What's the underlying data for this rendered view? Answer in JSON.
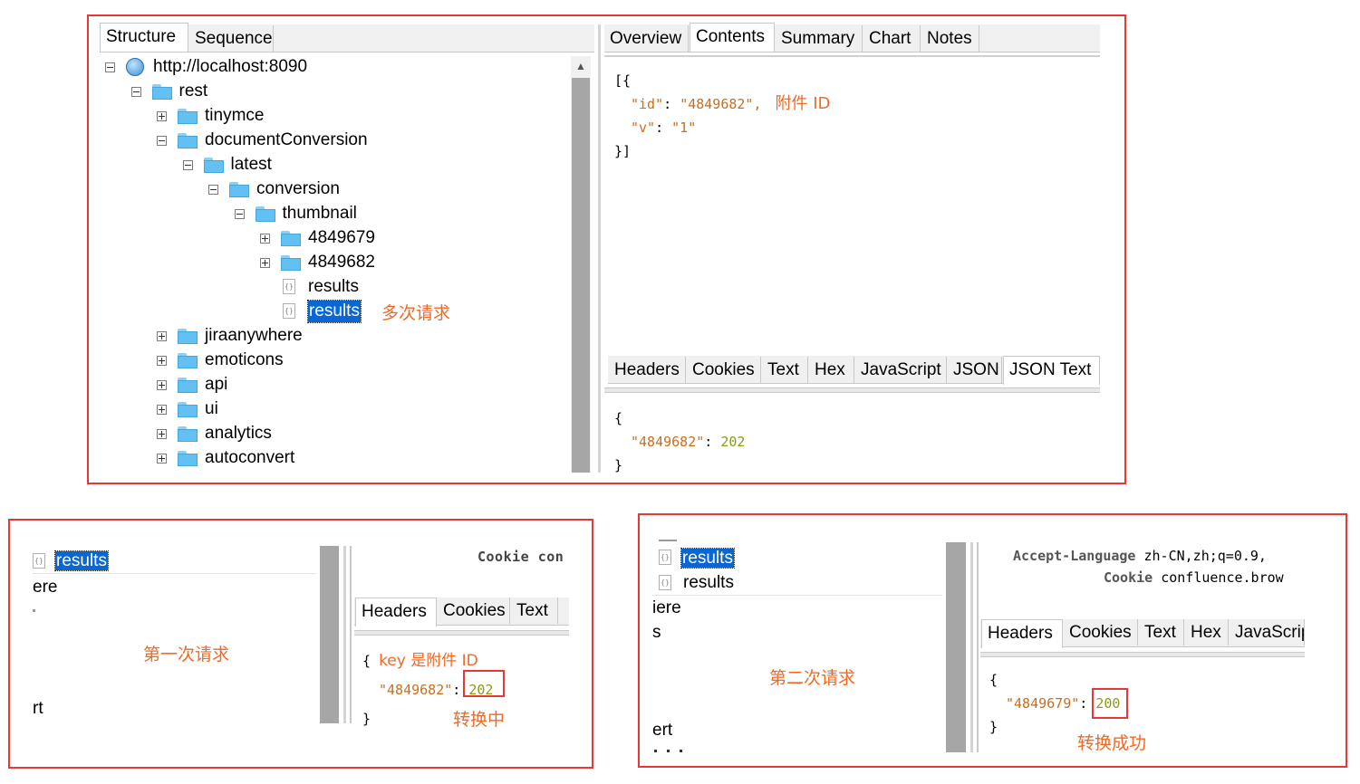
{
  "main": {
    "left_tabs": [
      "Structure",
      "Sequence"
    ],
    "right_tabs": [
      "Overview",
      "Contents",
      "Summary",
      "Chart",
      "Notes"
    ],
    "tree": [
      {
        "label": "http://localhost:8090",
        "icon": "globe-icon",
        "expander": "minus"
      },
      {
        "label": "rest",
        "icon": "folder-icon",
        "expander": "minus"
      },
      {
        "label": "tinymce",
        "icon": "folder-icon",
        "expander": "plus"
      },
      {
        "label": "documentConversion",
        "icon": "folder-icon",
        "expander": "minus"
      },
      {
        "label": "latest",
        "icon": "folder-icon",
        "expander": "minus"
      },
      {
        "label": "conversion",
        "icon": "folder-icon",
        "expander": "minus"
      },
      {
        "label": "thumbnail",
        "icon": "folder-icon",
        "expander": "minus"
      },
      {
        "label": "4849679",
        "icon": "folder-icon",
        "expander": "plus"
      },
      {
        "label": "4849682",
        "icon": "folder-icon",
        "expander": "plus"
      },
      {
        "label": "results",
        "icon": "json-file-icon",
        "expander": "none"
      },
      {
        "label": "results",
        "icon": "json-file-icon",
        "expander": "none",
        "selected": true
      },
      {
        "label": "jiraanywhere",
        "icon": "folder-icon",
        "expander": "plus"
      },
      {
        "label": "emoticons",
        "icon": "folder-icon",
        "expander": "plus"
      },
      {
        "label": "api",
        "icon": "folder-icon",
        "expander": "plus"
      },
      {
        "label": "ui",
        "icon": "folder-icon",
        "expander": "plus"
      },
      {
        "label": "analytics",
        "icon": "folder-icon",
        "expander": "plus"
      },
      {
        "label": "autoconvert",
        "icon": "folder-icon",
        "expander": "plus"
      }
    ],
    "annotation_multiple": "多次请求",
    "request_body": {
      "open": "[{",
      "id_key": "\"id\"",
      "id_value": "\"4849682\",",
      "v_key": "\"v\"",
      "v_value": "\"1\"",
      "close": "}]",
      "note": "附件 ID"
    },
    "bottom_tabs": [
      "Headers",
      "Cookies",
      "Text",
      "Hex",
      "JavaScript",
      "JSON",
      "JSON Text"
    ],
    "response_body": {
      "open": "{",
      "key": "\"4849682\"",
      "value": "202",
      "close": "}"
    }
  },
  "first": {
    "selected_label": "results",
    "partial_lines": [
      "ere",
      "rt"
    ],
    "header_partial": "Cookie con",
    "tabs": [
      "Headers",
      "Cookies",
      "Text"
    ],
    "key_note": "key 是附件 ID",
    "response": {
      "open": "{",
      "key": "\"4849682\"",
      "value": "202",
      "close": "}"
    },
    "caption": "第一次请求",
    "status_note": "转换中"
  },
  "second": {
    "tree_labels": [
      "results",
      "results"
    ],
    "partial_lines": [
      "iere",
      "s",
      "ert"
    ],
    "header_lines": [
      {
        "name": "Accept-Language",
        "value": "zh-CN,zh;q=0.9,"
      },
      {
        "name": "Cookie",
        "value": "confluence.brow"
      }
    ],
    "tabs": [
      "Headers",
      "Cookies",
      "Text",
      "Hex",
      "JavaScrip"
    ],
    "response": {
      "open": "{",
      "key": "\"4849679\"",
      "value": "200",
      "close": "}"
    },
    "caption": "第二次请求",
    "status_note": "转换成功"
  },
  "colors": {
    "frame": "#e53935",
    "annotation": "#f06a25",
    "selection": "#0a66d1",
    "json_string": "#c86f1f",
    "json_number": "#8a9a1a"
  }
}
